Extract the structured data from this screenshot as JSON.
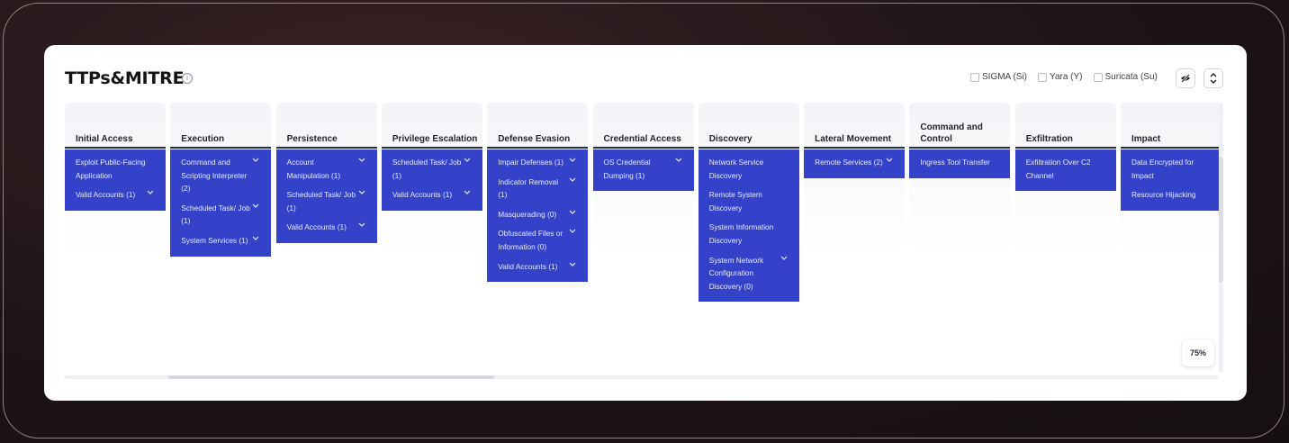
{
  "header": {
    "title": "TTPs&MITRE",
    "info_icon": "info-icon",
    "filters": [
      {
        "label": "SIGMA (Si)",
        "checked": false
      },
      {
        "label": "Yara (Y)",
        "checked": false
      },
      {
        "label": "Suricata (Su)",
        "checked": false
      }
    ],
    "tools": [
      "eye-off-icon",
      "expand-vertical-icon"
    ]
  },
  "tactics": [
    {
      "name": "Initial Access",
      "techniques": [
        {
          "label": "Exploit Public-Facing Application",
          "expandable": false
        },
        {
          "label": "Valid Accounts (1)",
          "expandable": true
        }
      ]
    },
    {
      "name": "Execution",
      "techniques": [
        {
          "label": "Command and Scripting Interpreter (2)",
          "expandable": true
        },
        {
          "label": "Scheduled Task/ Job (1)",
          "expandable": true
        },
        {
          "label": "System Services (1)",
          "expandable": true
        }
      ]
    },
    {
      "name": "Persistence",
      "techniques": [
        {
          "label": "Account Manipulation (1)",
          "expandable": true
        },
        {
          "label": "Scheduled Task/ Job (1)",
          "expandable": true
        },
        {
          "label": "Valid Accounts (1)",
          "expandable": true
        }
      ]
    },
    {
      "name": "Privilege Escalation",
      "techniques": [
        {
          "label": "Scheduled Task/ Job (1)",
          "expandable": true
        },
        {
          "label": "Valid Accounts (1)",
          "expandable": true
        }
      ]
    },
    {
      "name": "Defense Evasion",
      "techniques": [
        {
          "label": "Impair Defenses (1)",
          "expandable": true
        },
        {
          "label": "Indicator Removal (1)",
          "expandable": true
        },
        {
          "label": "Masquerading (0)",
          "expandable": true
        },
        {
          "label": "Obfuscated Files or Information (0)",
          "expandable": true
        },
        {
          "label": "Valid Accounts (1)",
          "expandable": true
        }
      ]
    },
    {
      "name": "Credential Access",
      "techniques": [
        {
          "label": "OS Credential Dumping (1)",
          "expandable": true
        }
      ]
    },
    {
      "name": "Discovery",
      "techniques": [
        {
          "label": "Network Service Discovery",
          "expandable": false
        },
        {
          "label": "Remote System Discovery",
          "expandable": false
        },
        {
          "label": "System Information Discovery",
          "expandable": false
        },
        {
          "label": "System Network Configuration Discovery (0)",
          "expandable": true
        }
      ]
    },
    {
      "name": "Lateral Movement",
      "techniques": [
        {
          "label": "Remote Services (2)",
          "expandable": true
        }
      ]
    },
    {
      "name": "Command and Control",
      "techniques": [
        {
          "label": "Ingress Tool Transfer",
          "expandable": false
        }
      ]
    },
    {
      "name": "Exfiltration",
      "techniques": [
        {
          "label": "Exfiltration Over C2 Channel",
          "expandable": false
        }
      ]
    },
    {
      "name": "Impact",
      "techniques": [
        {
          "label": "Data Encrypted for Impact",
          "expandable": false
        },
        {
          "label": "Resource Hijacking",
          "expandable": false
        }
      ]
    }
  ],
  "zoom": "75%",
  "colors": {
    "technique_bg": "#3342c8",
    "header_bg": "#f2f4f7",
    "title_text": "#121418"
  }
}
